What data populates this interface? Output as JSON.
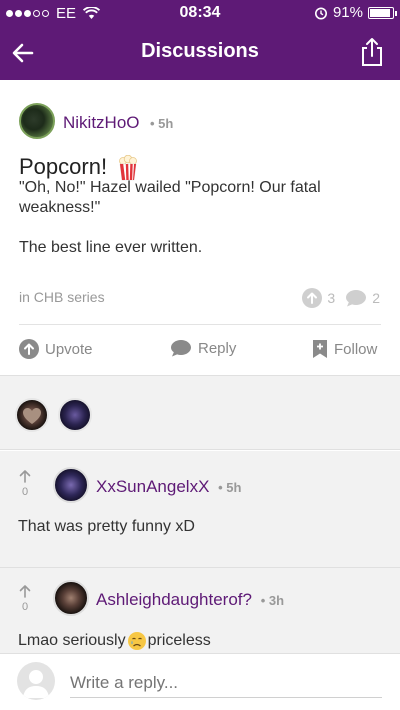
{
  "status": {
    "carrier": "EE",
    "time": "08:34",
    "battery": "91%",
    "battery_level": 0.91
  },
  "nav": {
    "title": "Discussions",
    "back_icon": "arrow-left-icon",
    "share_icon": "share-icon"
  },
  "post": {
    "author": "NikitzHoO",
    "time": "• 5h",
    "title": "Popcorn!",
    "body": [
      "\"Oh, No!\" Hazel wailed \"Popcorn! Our fatal weakness!\"",
      "The best line ever written."
    ],
    "category": "in CHB series",
    "upvote_count": "3",
    "comment_count": "2",
    "actions": {
      "upvote": "Upvote",
      "reply": "Reply",
      "follow": "Follow"
    }
  },
  "comments": [
    {
      "author": "XxSunAngelxX",
      "time": "• 5h",
      "votes": "0",
      "text": "That was pretty funny xD"
    },
    {
      "author": "Ashleighdaughterof?",
      "time": "• 3h",
      "votes": "0",
      "text": "Lmao seriously",
      "text_after": " priceless"
    }
  ],
  "reply": {
    "placeholder": "Write a reply..."
  },
  "colors": {
    "brand": "#5e1a76",
    "muted": "#999999",
    "band": "#f2f2f2"
  }
}
